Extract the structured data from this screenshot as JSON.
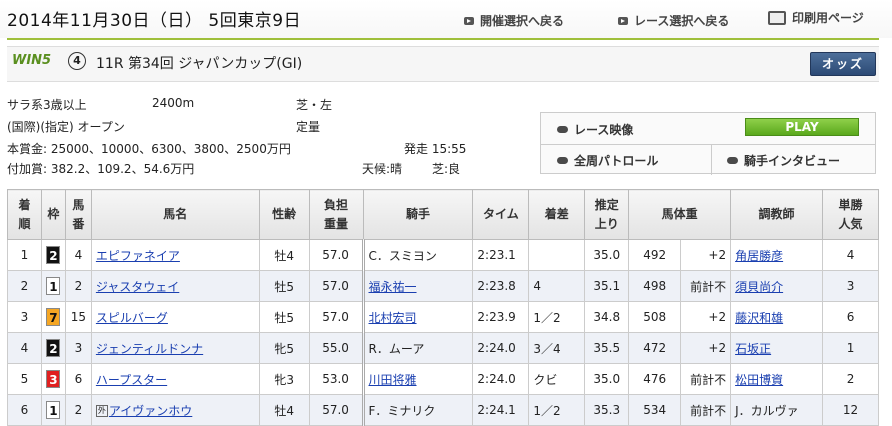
{
  "header": {
    "date_title": "2014年11月30日（日） 5回東京9日",
    "nav_back_kaisai": "開催選択へ戻る",
    "nav_back_race": "レース選択へ戻る",
    "nav_print": "印刷用ページ"
  },
  "race": {
    "win5_logo": "WIN5",
    "win5_number": "4",
    "title": "11R 第34回 ジャパンカップ(GI)",
    "odds_button": "オッズ",
    "condition": "サラ系3歳以上",
    "distance": "2400m",
    "course": "芝・左",
    "class": "(国際)(指定) オープン",
    "weight_rule": "定量",
    "prize": "本賞金: 25000、10000、6300、3800、2500万円",
    "extra_prize": "付加賞: 382.2、109.2、54.6万円",
    "post_time": "発走 15:55",
    "weather": "天候:晴",
    "going": "芝:良"
  },
  "media": {
    "race_video": "レース映像",
    "play": "PLAY",
    "patrol": "全周パトロール",
    "interview": "騎手インタビュー"
  },
  "colors": {
    "accent": "#9fbf3b",
    "link": "#1a3fb0",
    "odds_button": "#2c4a75"
  },
  "table": {
    "headers": {
      "finish": [
        "着",
        "順"
      ],
      "frame": "枠",
      "horse_num": [
        "馬",
        "番"
      ],
      "horse_name": "馬名",
      "sex_age": "性齢",
      "weight_carried": [
        "負担",
        "重量"
      ],
      "jockey": "騎手",
      "time": "タイム",
      "margin": "着差",
      "last3f": [
        "推定",
        "上り"
      ],
      "body_weight": "馬体重",
      "trainer": "調教師",
      "popularity": [
        "単勝",
        "人気"
      ]
    },
    "rows": [
      {
        "finish": "1",
        "frame": "2",
        "frame_color": "#111111",
        "frame_text": "#ffffff",
        "num": "4",
        "name": "エピファネイア",
        "icon": "",
        "sexage": "牡4",
        "load": "57.0",
        "jockey": "C．スミヨン",
        "jockey_link": false,
        "time": "2:23.1",
        "margin": "",
        "last3f": "35.0",
        "bw": "492",
        "bwdiff": "+2",
        "trainer": "角居勝彦",
        "trainer_link": true,
        "pop": "4"
      },
      {
        "finish": "2",
        "frame": "1",
        "frame_color": "#ffffff",
        "frame_text": "#111111",
        "num": "2",
        "name": "ジャスタウェイ",
        "icon": "",
        "sexage": "牡5",
        "load": "57.0",
        "jockey": "福永祐一",
        "jockey_link": true,
        "time": "2:23.8",
        "margin": "4",
        "last3f": "35.1",
        "bw": "498",
        "bwdiff": "前計不",
        "trainer": "須貝尚介",
        "trainer_link": true,
        "pop": "3"
      },
      {
        "finish": "3",
        "frame": "7",
        "frame_color": "#f5a623",
        "frame_text": "#111111",
        "num": "15",
        "name": "スピルバーグ",
        "icon": "",
        "sexage": "牡5",
        "load": "57.0",
        "jockey": "北村宏司",
        "jockey_link": true,
        "time": "2:23.9",
        "margin": "1／2",
        "last3f": "34.8",
        "bw": "508",
        "bwdiff": "+2",
        "trainer": "藤沢和雄",
        "trainer_link": true,
        "pop": "6"
      },
      {
        "finish": "4",
        "frame": "2",
        "frame_color": "#111111",
        "frame_text": "#ffffff",
        "num": "3",
        "name": "ジェンティルドンナ",
        "icon": "",
        "sexage": "牝5",
        "load": "55.0",
        "jockey": "R．ムーア",
        "jockey_link": false,
        "time": "2:24.0",
        "margin": "3／4",
        "last3f": "35.5",
        "bw": "472",
        "bwdiff": "+2",
        "trainer": "石坂正",
        "trainer_link": true,
        "pop": "1"
      },
      {
        "finish": "5",
        "frame": "3",
        "frame_color": "#e02020",
        "frame_text": "#ffffff",
        "num": "6",
        "name": "ハープスター",
        "icon": "",
        "sexage": "牝3",
        "load": "53.0",
        "jockey": "川田将雅",
        "jockey_link": true,
        "time": "2:24.0",
        "margin": "クビ",
        "last3f": "35.0",
        "bw": "476",
        "bwdiff": "前計不",
        "trainer": "松田博資",
        "trainer_link": true,
        "pop": "2"
      },
      {
        "finish": "6",
        "frame": "1",
        "frame_color": "#ffffff",
        "frame_text": "#111111",
        "num": "2",
        "name": "アイヴァンホウ",
        "icon": "外",
        "sexage": "牡4",
        "load": "57.0",
        "jockey": "F．ミナリク",
        "jockey_link": false,
        "time": "2:24.1",
        "margin": "1／2",
        "last3f": "35.3",
        "bw": "534",
        "bwdiff": "前計不",
        "trainer": "J．カルヴァ",
        "trainer_link": false,
        "pop": "12"
      }
    ]
  }
}
